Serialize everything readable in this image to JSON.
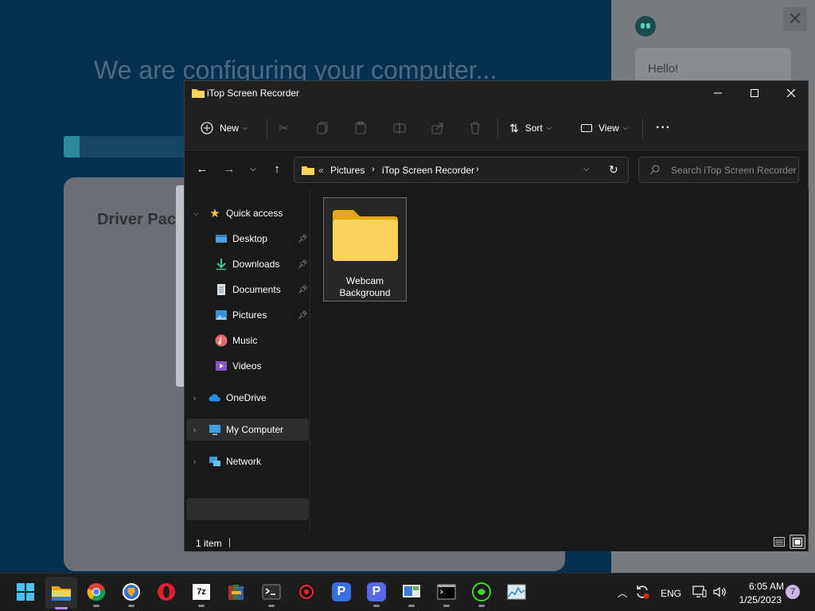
{
  "background_app": {
    "headline": "We are configuring your computer...",
    "card_title": "Driver Pac"
  },
  "chat": {
    "greeting": "Hello!",
    "close_icon": "close-icon"
  },
  "window": {
    "title": "iTop Screen Recorder",
    "toolbar": {
      "new_label": "New",
      "sort_label": "Sort",
      "view_label": "View"
    },
    "address": {
      "overflow": "«",
      "crumbs": [
        "Pictures",
        "iTop Screen Recorder"
      ]
    },
    "search": {
      "placeholder": "Search iTop Screen Recorder"
    },
    "sidebar": {
      "quick_access": "Quick access",
      "items": [
        {
          "label": "Desktop",
          "icon": "desktop-icon",
          "pinned": true
        },
        {
          "label": "Downloads",
          "icon": "downloads-icon",
          "pinned": true
        },
        {
          "label": "Documents",
          "icon": "documents-icon",
          "pinned": true
        },
        {
          "label": "Pictures",
          "icon": "pictures-icon",
          "pinned": true
        },
        {
          "label": "Music",
          "icon": "music-icon",
          "pinned": false
        },
        {
          "label": "Videos",
          "icon": "videos-icon",
          "pinned": false
        }
      ],
      "onedrive": "OneDrive",
      "my_computer": "My Computer",
      "network": "Network"
    },
    "content": {
      "items": [
        {
          "name_line1": "Webcam",
          "name_line2": "Background",
          "type": "folder"
        }
      ]
    },
    "status": {
      "count": "1 item"
    }
  },
  "taskbar": {
    "apps": [
      "start",
      "file-explorer",
      "chrome",
      "brave",
      "opera",
      "7zip",
      "winrar",
      "terminal",
      "davinci",
      "p-app-1",
      "p-app-2",
      "remote-desktop",
      "cmd",
      "razer",
      "resource-monitor"
    ],
    "language": "ENG",
    "time": "6:05 AM",
    "date": "1/25/2023",
    "notifications": "7"
  },
  "colors": {
    "folder": "#f6c94a",
    "accent": "#0a6ec7",
    "selected_row": "#2d2d2d"
  }
}
